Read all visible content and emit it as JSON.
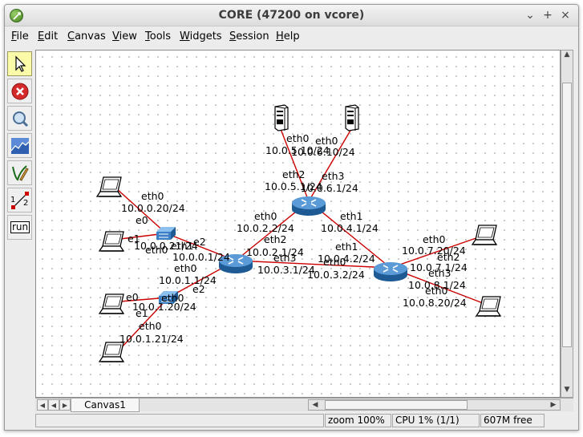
{
  "window": {
    "title": "CORE (47200 on vcore)",
    "controls": [
      "⌄",
      "+",
      "×"
    ]
  },
  "menu": [
    {
      "pre": "",
      "u": "F",
      "post": "ile"
    },
    {
      "pre": "",
      "u": "E",
      "post": "dit"
    },
    {
      "pre": "",
      "u": "C",
      "post": "anvas"
    },
    {
      "pre": "",
      "u": "V",
      "post": "iew"
    },
    {
      "pre": "",
      "u": "T",
      "post": "ools"
    },
    {
      "pre": "",
      "u": "W",
      "post": "idgets"
    },
    {
      "pre": "",
      "u": "S",
      "post": "ession"
    },
    {
      "pre": "",
      "u": "H",
      "post": "elp"
    }
  ],
  "toolbar": {
    "tools": [
      "select-tool",
      "stop-tool",
      "zoom-tool",
      "plot-tool",
      "marker-tool",
      "two-node-tool",
      "run-tool"
    ],
    "run_label": "run",
    "two_node_labels": [
      "1",
      "2"
    ],
    "active": "select-tool"
  },
  "colors": {
    "link": "#cc0000",
    "router": "#3b7fc4",
    "switch": "#3b7fc4"
  },
  "canvas": {
    "tab": "Canvas1",
    "labels": {
      "s1eth0": "eth0",
      "s1ip": "10.0.5.10/24",
      "s2eth0": "eth0",
      "s2ip": "10.0.6.10/24",
      "r1eth2": "eth2",
      "r1eth2ip": "10.0.5.1/24",
      "r1eth3": "eth3",
      "r1eth3ip": "10.0.6.1/24",
      "r1eth0": "eth0",
      "r1eth0ip": "10.0.2.2/24",
      "r1eth1": "eth1",
      "r1eth1ip": "10.0.4.1/24",
      "l1eth0": "eth0",
      "l1ip": "10.0.0.20/24",
      "l2eth0": "eth0",
      "l2ip": "10.0.0.21/24",
      "sw1e0": "e0",
      "sw1e1": "e1",
      "sw1e2": "e2",
      "r0eth0ip0": "10.0.0.1/24",
      "r0eth1": "eth1",
      "r0eth0": "eth0",
      "r0eth0ip": "10.0.1.1/24",
      "r0eth2": "eth2",
      "r0eth2ip": "10.0.2.1/24",
      "r0eth3": "eth3",
      "r0eth3ip": "10.0.3.1/24",
      "sw2e0": "e0",
      "sw2e1": "e1",
      "sw2e2": "e2",
      "l3eth0": "eth0",
      "l3ip": "10.0.1.20/24",
      "l4eth0": "eth0",
      "l4ip": "10.0.1.21/24",
      "r2eth1": "eth1",
      "r2eth1ip": "10.0.4.2/24",
      "r2eth0": "eth0",
      "r2eth0ip": "10.0.3.2/24",
      "r2eth2": "eth2",
      "r2eth2ip": "10.0.7.1/24",
      "r2eth3": "eth3",
      "r2eth3ip": "10.0.8.1/24",
      "l5eth0": "eth0",
      "l5ip": "10.0.7.20/24",
      "l6eth0": "eth0",
      "l6ip": "10.0.8.20/24"
    }
  },
  "status": {
    "zoom": "zoom 100%",
    "cpu": "CPU 1% (1/1)",
    "mem": "607M free"
  }
}
